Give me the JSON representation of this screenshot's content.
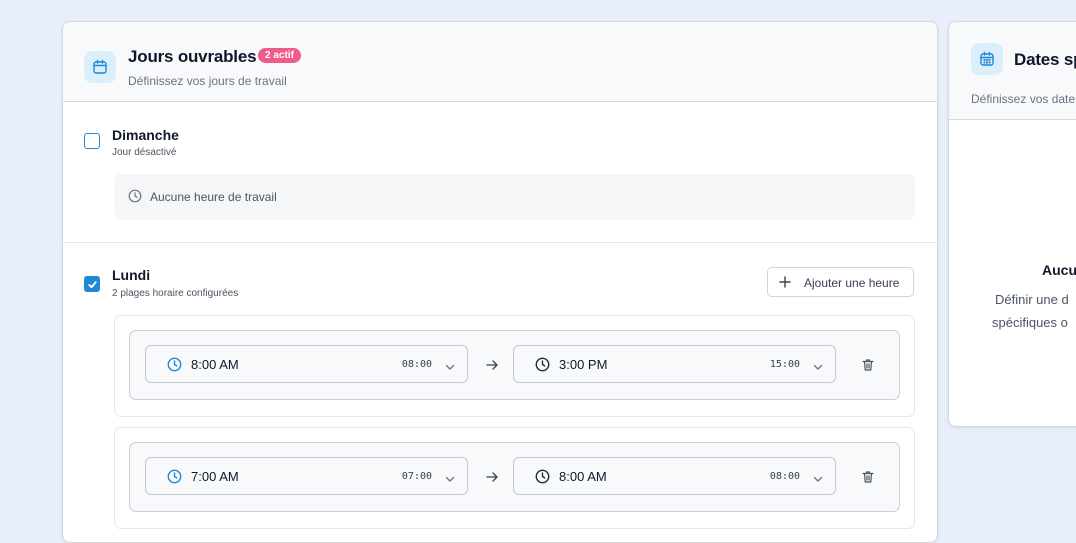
{
  "working_days": {
    "title": "Jours ouvrables",
    "badge": "2 actif",
    "subtitle": "Définissez vos jours de travail",
    "days": [
      {
        "name": "Dimanche",
        "status": "Jour désactivé",
        "checked": false,
        "empty_text": "Aucune heure de travail"
      },
      {
        "name": "Lundi",
        "status": "2 plages horaire configurées",
        "checked": true,
        "add_label": "Ajouter une heure",
        "slots": [
          {
            "start_label": "8:00 AM",
            "start_value": "08:00",
            "end_label": "3:00 PM",
            "end_value": "15:00"
          },
          {
            "start_label": "7:00 AM",
            "start_value": "07:00",
            "end_label": "8:00 AM",
            "end_value": "08:00"
          }
        ]
      }
    ]
  },
  "special_dates": {
    "title": "Dates sp",
    "subtitle": "Définissez vos date",
    "empty_title": "Aucu",
    "empty_desc_line1": "Définir une d",
    "empty_desc_line2": "spécifiques o"
  },
  "colors": {
    "accent": "#1e88d4",
    "badge": "#f15b8a",
    "background": "#e9eefb"
  },
  "icons": [
    "calendar-icon",
    "clock-icon",
    "plus-icon",
    "arrow-right-icon",
    "chevron-down-icon",
    "trash-icon",
    "check-icon"
  ]
}
